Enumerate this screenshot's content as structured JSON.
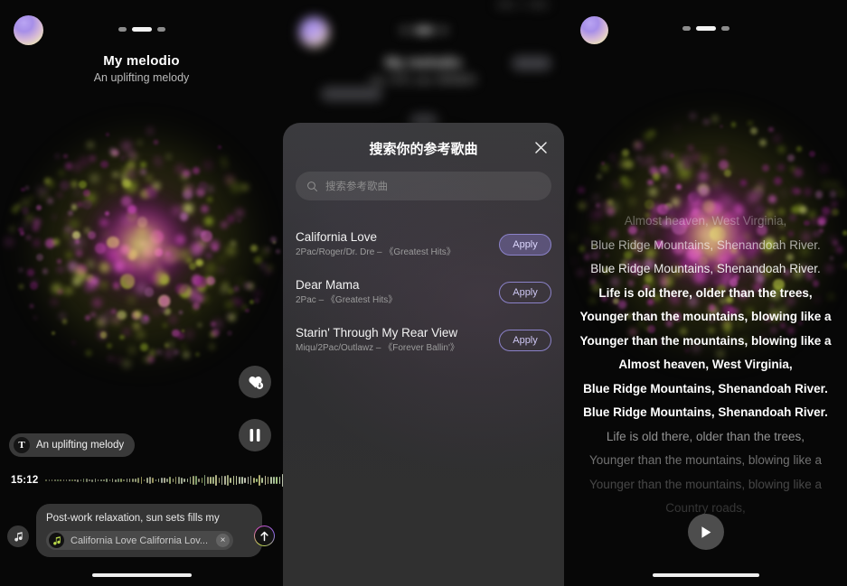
{
  "app": {
    "panel1": {
      "title": "My melodio",
      "subtitle": "An uplifting melody",
      "avatar_name": "user-avatar",
      "pager": {
        "count": 3,
        "active_index": 1
      },
      "tag_chip": {
        "icon": "text-icon",
        "label": "An uplifting melody"
      },
      "timeline": {
        "time": "15:12",
        "shuffle_icon": "shuffle-icon"
      },
      "favorite_button": {
        "icon": "heart-download-icon"
      },
      "play_pause_button": {
        "icon": "pause-icon",
        "state": "playing"
      },
      "prompt_card": {
        "text": "Post-work relaxation, sun sets fills my",
        "chip_icon": "music-note-icon",
        "chip_label": "California Love California Lov...",
        "chip_remove": "×"
      },
      "music_note_button": {
        "icon": "music-note-icon"
      },
      "send_button": {
        "icon": "arrow-up-icon"
      }
    },
    "panel2": {
      "backdrop": {
        "title": "My melodio",
        "subtitle": "rap, 文艺, pop, 轻快音乐"
      },
      "modal": {
        "title": "搜索你的参考歌曲",
        "close_icon": "close-icon",
        "search": {
          "icon": "search-icon",
          "placeholder": "搜索参考歌曲",
          "value": ""
        },
        "songs": [
          {
            "name": "California Love",
            "meta": "2Pac/Roger/Dr. Dre – 《Greatest Hits》",
            "apply_label": "Apply",
            "selected": true
          },
          {
            "name": "Dear Mama",
            "meta": "2Pac – 《Greatest Hits》",
            "apply_label": "Apply",
            "selected": false
          },
          {
            "name": "Starin' Through My Rear View",
            "meta": "Miqu/2Pac/Outlawz – 《Forever Ballin'》",
            "apply_label": "Apply",
            "selected": false
          }
        ]
      }
    },
    "panel3": {
      "avatar_name": "user-avatar",
      "pager": {
        "count": 3,
        "active_index": 1
      },
      "lyrics": [
        {
          "text": "Almost heaven, West Virginia,",
          "opacity": 0.32,
          "weight": 400
        },
        {
          "text": "Blue Ridge Mountains, Shenandoah River.",
          "opacity": 0.62,
          "weight": 400
        },
        {
          "text": "Blue Ridge Mountains, Shenandoah River.",
          "opacity": 0.9,
          "weight": 400
        },
        {
          "text": "Life is old there, older than the trees,",
          "opacity": 1.0,
          "weight": 700
        },
        {
          "text": "Younger than the mountains, blowing like a",
          "opacity": 1.0,
          "weight": 700
        },
        {
          "text": "Younger than the mountains, blowing like a",
          "opacity": 1.0,
          "weight": 700
        },
        {
          "text": "Almost heaven, West Virginia,",
          "opacity": 1.0,
          "weight": 700
        },
        {
          "text": "Blue Ridge Mountains, Shenandoah River.",
          "opacity": 1.0,
          "weight": 700
        },
        {
          "text": "Blue Ridge Mountains, Shenandoah River.",
          "opacity": 1.0,
          "weight": 700
        },
        {
          "text": "Life is old there, older than the trees,",
          "opacity": 0.55,
          "weight": 400
        },
        {
          "text": "Younger than the mountains, blowing like a",
          "opacity": 0.42,
          "weight": 400
        },
        {
          "text": "Younger than the mountains, blowing like a",
          "opacity": 0.25,
          "weight": 400
        },
        {
          "text": "Country roads,",
          "opacity": 0.18,
          "weight": 400
        }
      ],
      "play_button": {
        "icon": "play-icon"
      }
    }
  },
  "colors": {
    "accent_purple": "#8b82c9",
    "accent_purple_fill": "#766caa",
    "particle_magenta": "#c23ab0",
    "particle_lime": "#a8c72a",
    "sheet_bg": "#343436",
    "text_primary": "#ffffff",
    "text_secondary": "#9c9c9c"
  }
}
